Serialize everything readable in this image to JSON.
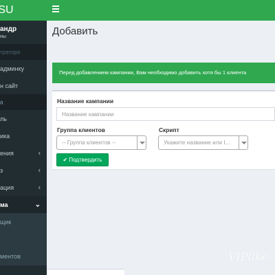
{
  "app": {
    "logo": "3.SU"
  },
  "user": {
    "name": "андр",
    "status": "ны"
  },
  "sidebar": {
    "items": [
      {
        "label": "тратора",
        "kind": "header"
      },
      {
        "label": "админку",
        "kind": "link"
      },
      {
        "label": "н сайт",
        "kind": "link"
      },
      {
        "label": "а",
        "kind": "header"
      },
      {
        "label": "ль",
        "kind": "link"
      },
      {
        "label": "ика",
        "kind": "link"
      },
      {
        "label": "ения",
        "kind": "tree",
        "chevron": "‹"
      },
      {
        "label": "з",
        "kind": "tree",
        "chevron": "‹"
      },
      {
        "label": "ация",
        "kind": "tree",
        "chevron": "‹"
      },
      {
        "label": "ма",
        "kind": "active",
        "chevron": "⌄"
      },
      {
        "label": "щик",
        "kind": "sub"
      },
      {
        "label": "ментов",
        "kind": "sub"
      }
    ]
  },
  "page": {
    "title": "Добавить"
  },
  "alert": {
    "text": "Перед добавлением кампании, Вам необходимо добавить хотя бы 1 клиента"
  },
  "form": {
    "campaign_label": "Название кампании",
    "campaign_placeholder": "Название кампании",
    "group_label": "Группа клиентов",
    "group_value": "-- Группа клиентов --",
    "script_label": "Скрипт",
    "script_value": "Укажите название или I...",
    "submit_label": "Подтвердить"
  },
  "watermark": {
    "text": "VIPlike"
  },
  "colors": {
    "brand": "#2fa84f",
    "sidebar": "#222d32",
    "button": "#00a65a"
  }
}
